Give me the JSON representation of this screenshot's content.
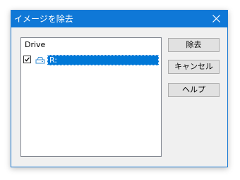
{
  "window": {
    "title": "イメージを除去"
  },
  "list": {
    "header": "Drive",
    "rows": [
      {
        "label": "R:",
        "checked": true,
        "selected": true,
        "icon": "drive-icon"
      }
    ]
  },
  "buttons": {
    "remove": "除去",
    "cancel": "キャンセル",
    "help": "ヘルプ"
  },
  "colors": {
    "titlebar": "#0f78d7",
    "selection": "#0078d7",
    "dialog_bg": "#f0f0f0"
  }
}
